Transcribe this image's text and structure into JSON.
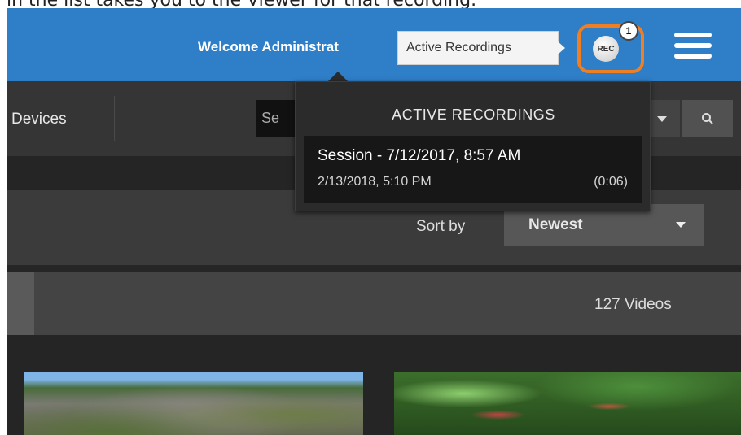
{
  "caption": "in the list takes you to the Viewer for that recording.",
  "header": {
    "welcome_text": "Welcome Administrat",
    "tooltip": "Active Recordings",
    "rec_label": "REC",
    "rec_badge_count": "1",
    "accent_color": "#2f7ec8",
    "highlight_color": "#ef7f22"
  },
  "nav": {
    "devices_label": "Devices",
    "search_value": "Se"
  },
  "active_recordings_popup": {
    "title": "ACTIVE RECORDINGS",
    "items": [
      {
        "session": "Session - 7/12/2017, 8:57 AM",
        "date": "2/13/2018, 5:10 PM",
        "duration": "(0:06)"
      }
    ]
  },
  "sort": {
    "label": "Sort by",
    "selected": "Newest"
  },
  "videos": {
    "count_text": "127 Videos"
  },
  "icons": [
    "menu-icon",
    "search-icon",
    "chevron-down-icon",
    "rec-icon"
  ]
}
